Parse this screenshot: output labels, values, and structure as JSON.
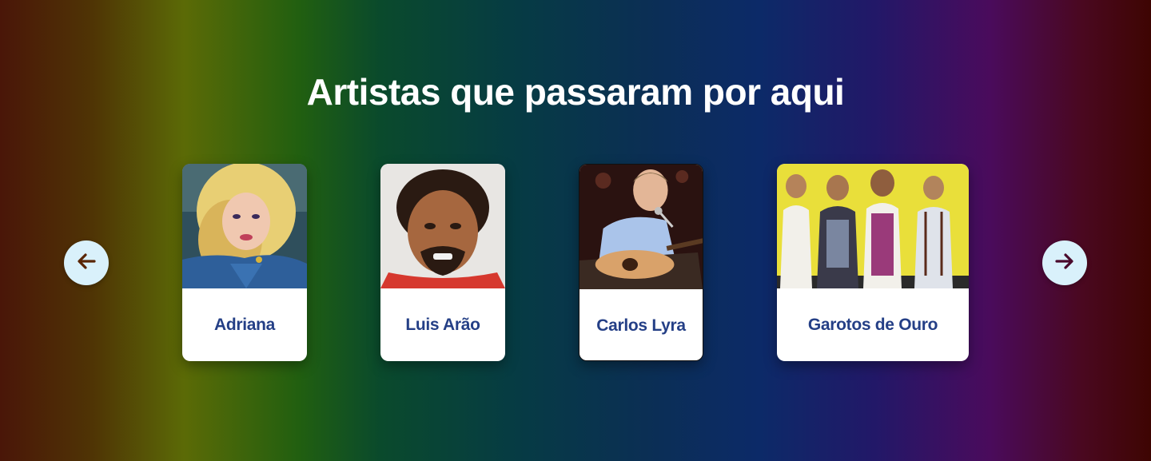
{
  "section": {
    "title": "Artistas que passaram por aqui"
  },
  "carousel": {
    "prev_icon": "arrow-left-icon",
    "next_icon": "arrow-right-icon",
    "arrow_color_prev": "#5a2606",
    "arrow_color_next": "#4a0a2c",
    "button_bg": "#d9f1fb",
    "name_color": "#243f86",
    "artists": [
      {
        "name": "Adriana",
        "photo": "adriana-photo"
      },
      {
        "name": "Luis Arão",
        "photo": "luis-arao-photo"
      },
      {
        "name": "Carlos Lyra",
        "photo": "carlos-lyra-photo"
      },
      {
        "name": "Garotos de Ouro",
        "photo": "garotos-de-ouro-photo"
      }
    ]
  }
}
